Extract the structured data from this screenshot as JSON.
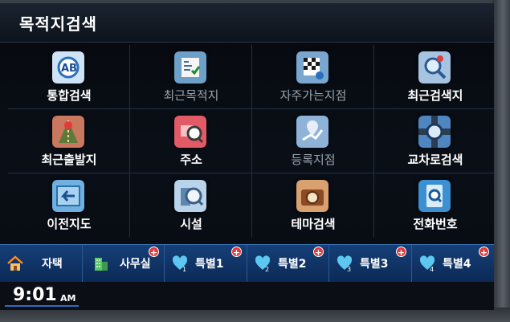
{
  "header": {
    "title": "목적지검색"
  },
  "menu": [
    {
      "label": "통합검색",
      "icon": "unified-search-icon",
      "enabled": true
    },
    {
      "label": "최근목적지",
      "icon": "recent-destination-icon",
      "enabled": false
    },
    {
      "label": "자주가는지점",
      "icon": "frequent-places-icon",
      "enabled": false
    },
    {
      "label": "최근검색지",
      "icon": "recent-search-icon",
      "enabled": true
    },
    {
      "label": "최근출발지",
      "icon": "recent-departure-icon",
      "enabled": true
    },
    {
      "label": "주소",
      "icon": "address-icon",
      "enabled": true
    },
    {
      "label": "등록지점",
      "icon": "registered-places-icon",
      "enabled": false
    },
    {
      "label": "교차로검색",
      "icon": "intersection-search-icon",
      "enabled": true
    },
    {
      "label": "이전지도",
      "icon": "previous-map-icon",
      "enabled": true
    },
    {
      "label": "시설",
      "icon": "facility-icon",
      "enabled": true
    },
    {
      "label": "테마검색",
      "icon": "theme-search-icon",
      "enabled": true
    },
    {
      "label": "전화번호",
      "icon": "phone-number-icon",
      "enabled": true
    }
  ],
  "shortcuts": [
    {
      "label": "자택",
      "icon": "home-icon",
      "badge": ""
    },
    {
      "label": "사무실",
      "icon": "office-icon",
      "badge": "+"
    },
    {
      "label": "특별1",
      "icon": "heart-1-icon",
      "badge": "+"
    },
    {
      "label": "특별2",
      "icon": "heart-2-icon",
      "badge": "+"
    },
    {
      "label": "특별3",
      "icon": "heart-3-icon",
      "badge": "+"
    },
    {
      "label": "특별4",
      "icon": "heart-4-icon",
      "badge": "+"
    }
  ],
  "status": {
    "time": "9:01",
    "ampm": "AM"
  },
  "colors": {
    "accent": "#2d6cc0",
    "shortcut_bg": "#163f78",
    "badge": "#e23a3a"
  }
}
